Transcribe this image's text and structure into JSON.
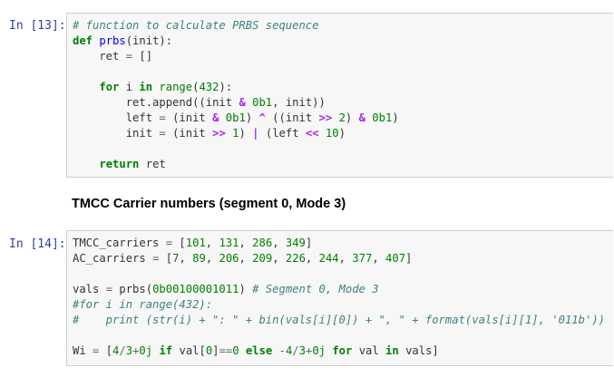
{
  "cell1": {
    "prompt": "In [13]:",
    "lines": [
      [
        {
          "t": "# function to calculate PRBS sequence",
          "c": "cm"
        }
      ],
      [
        {
          "t": "def",
          "c": "kw"
        },
        {
          "t": " "
        },
        {
          "t": "prbs",
          "c": "fn"
        },
        {
          "t": "(init):"
        }
      ],
      [
        {
          "t": "    ret "
        },
        {
          "t": "=",
          "c": "opn"
        },
        {
          "t": " []"
        }
      ],
      [],
      [
        {
          "t": "    "
        },
        {
          "t": "for",
          "c": "kw"
        },
        {
          "t": " i "
        },
        {
          "t": "in",
          "c": "kw"
        },
        {
          "t": " "
        },
        {
          "t": "range",
          "c": "bi"
        },
        {
          "t": "("
        },
        {
          "t": "432",
          "c": "num"
        },
        {
          "t": "):"
        }
      ],
      [
        {
          "t": "        ret.append((init "
        },
        {
          "t": "&",
          "c": "op"
        },
        {
          "t": " "
        },
        {
          "t": "0b1",
          "c": "num"
        },
        {
          "t": ", init))"
        }
      ],
      [
        {
          "t": "        left "
        },
        {
          "t": "=",
          "c": "opn"
        },
        {
          "t": " (init "
        },
        {
          "t": "&",
          "c": "op"
        },
        {
          "t": " "
        },
        {
          "t": "0b1",
          "c": "num"
        },
        {
          "t": ") "
        },
        {
          "t": "^",
          "c": "op"
        },
        {
          "t": " ((init "
        },
        {
          "t": ">>",
          "c": "op"
        },
        {
          "t": " "
        },
        {
          "t": "2",
          "c": "num"
        },
        {
          "t": ") "
        },
        {
          "t": "&",
          "c": "op"
        },
        {
          "t": " "
        },
        {
          "t": "0b1",
          "c": "num"
        },
        {
          "t": ")"
        }
      ],
      [
        {
          "t": "        init "
        },
        {
          "t": "=",
          "c": "opn"
        },
        {
          "t": " (init "
        },
        {
          "t": ">>",
          "c": "op"
        },
        {
          "t": " "
        },
        {
          "t": "1",
          "c": "num"
        },
        {
          "t": ") "
        },
        {
          "t": "|",
          "c": "op"
        },
        {
          "t": " (left "
        },
        {
          "t": "<<",
          "c": "op"
        },
        {
          "t": " "
        },
        {
          "t": "10",
          "c": "num"
        },
        {
          "t": ")"
        }
      ],
      [],
      [
        {
          "t": "    "
        },
        {
          "t": "return",
          "c": "kw"
        },
        {
          "t": " ret"
        }
      ]
    ]
  },
  "markdown": {
    "heading": "TMCC Carrier numbers (segment 0, Mode 3)"
  },
  "cell2": {
    "prompt": "In [14]:",
    "lines": [
      [
        {
          "t": "TMCC_carriers "
        },
        {
          "t": "=",
          "c": "opn"
        },
        {
          "t": " ["
        },
        {
          "t": "101",
          "c": "num"
        },
        {
          "t": ", "
        },
        {
          "t": "131",
          "c": "num"
        },
        {
          "t": ", "
        },
        {
          "t": "286",
          "c": "num"
        },
        {
          "t": ", "
        },
        {
          "t": "349",
          "c": "num"
        },
        {
          "t": "]"
        }
      ],
      [
        {
          "t": "AC_carriers "
        },
        {
          "t": "=",
          "c": "opn"
        },
        {
          "t": " ["
        },
        {
          "t": "7",
          "c": "num"
        },
        {
          "t": ", "
        },
        {
          "t": "89",
          "c": "num"
        },
        {
          "t": ", "
        },
        {
          "t": "206",
          "c": "num"
        },
        {
          "t": ", "
        },
        {
          "t": "209",
          "c": "num"
        },
        {
          "t": ", "
        },
        {
          "t": "226",
          "c": "num"
        },
        {
          "t": ", "
        },
        {
          "t": "244",
          "c": "num"
        },
        {
          "t": ", "
        },
        {
          "t": "377",
          "c": "num"
        },
        {
          "t": ", "
        },
        {
          "t": "407",
          "c": "num"
        },
        {
          "t": "]"
        }
      ],
      [],
      [
        {
          "t": "vals "
        },
        {
          "t": "=",
          "c": "opn"
        },
        {
          "t": " prbs("
        },
        {
          "t": "0b00100001011",
          "c": "num"
        },
        {
          "t": ") "
        },
        {
          "t": "# Segment 0, Mode 3",
          "c": "cm"
        }
      ],
      [
        {
          "t": "#for i in range(432):",
          "c": "cm"
        }
      ],
      [
        {
          "t": "#    print (str(i) + \": \" + bin(vals[i][0]) + \", \" + format(vals[i][1], '011b'))",
          "c": "cm"
        }
      ],
      [],
      [
        {
          "t": "Wi "
        },
        {
          "t": "=",
          "c": "opn"
        },
        {
          "t": " ["
        },
        {
          "t": "4",
          "c": "num"
        },
        {
          "t": "/",
          "c": "opn"
        },
        {
          "t": "3",
          "c": "num"
        },
        {
          "t": "+",
          "c": "opn"
        },
        {
          "t": "0j",
          "c": "num"
        },
        {
          "t": " "
        },
        {
          "t": "if",
          "c": "kw"
        },
        {
          "t": " val["
        },
        {
          "t": "0",
          "c": "num"
        },
        {
          "t": "]"
        },
        {
          "t": "==",
          "c": "opn"
        },
        {
          "t": "0",
          "c": "num"
        },
        {
          "t": " "
        },
        {
          "t": "else",
          "c": "kw"
        },
        {
          "t": " "
        },
        {
          "t": "-",
          "c": "opn"
        },
        {
          "t": "4",
          "c": "num"
        },
        {
          "t": "/",
          "c": "opn"
        },
        {
          "t": "3",
          "c": "num"
        },
        {
          "t": "+",
          "c": "opn"
        },
        {
          "t": "0j",
          "c": "num"
        },
        {
          "t": " "
        },
        {
          "t": "for",
          "c": "kw"
        },
        {
          "t": " val "
        },
        {
          "t": "in",
          "c": "kw"
        },
        {
          "t": " vals]"
        }
      ]
    ]
  }
}
